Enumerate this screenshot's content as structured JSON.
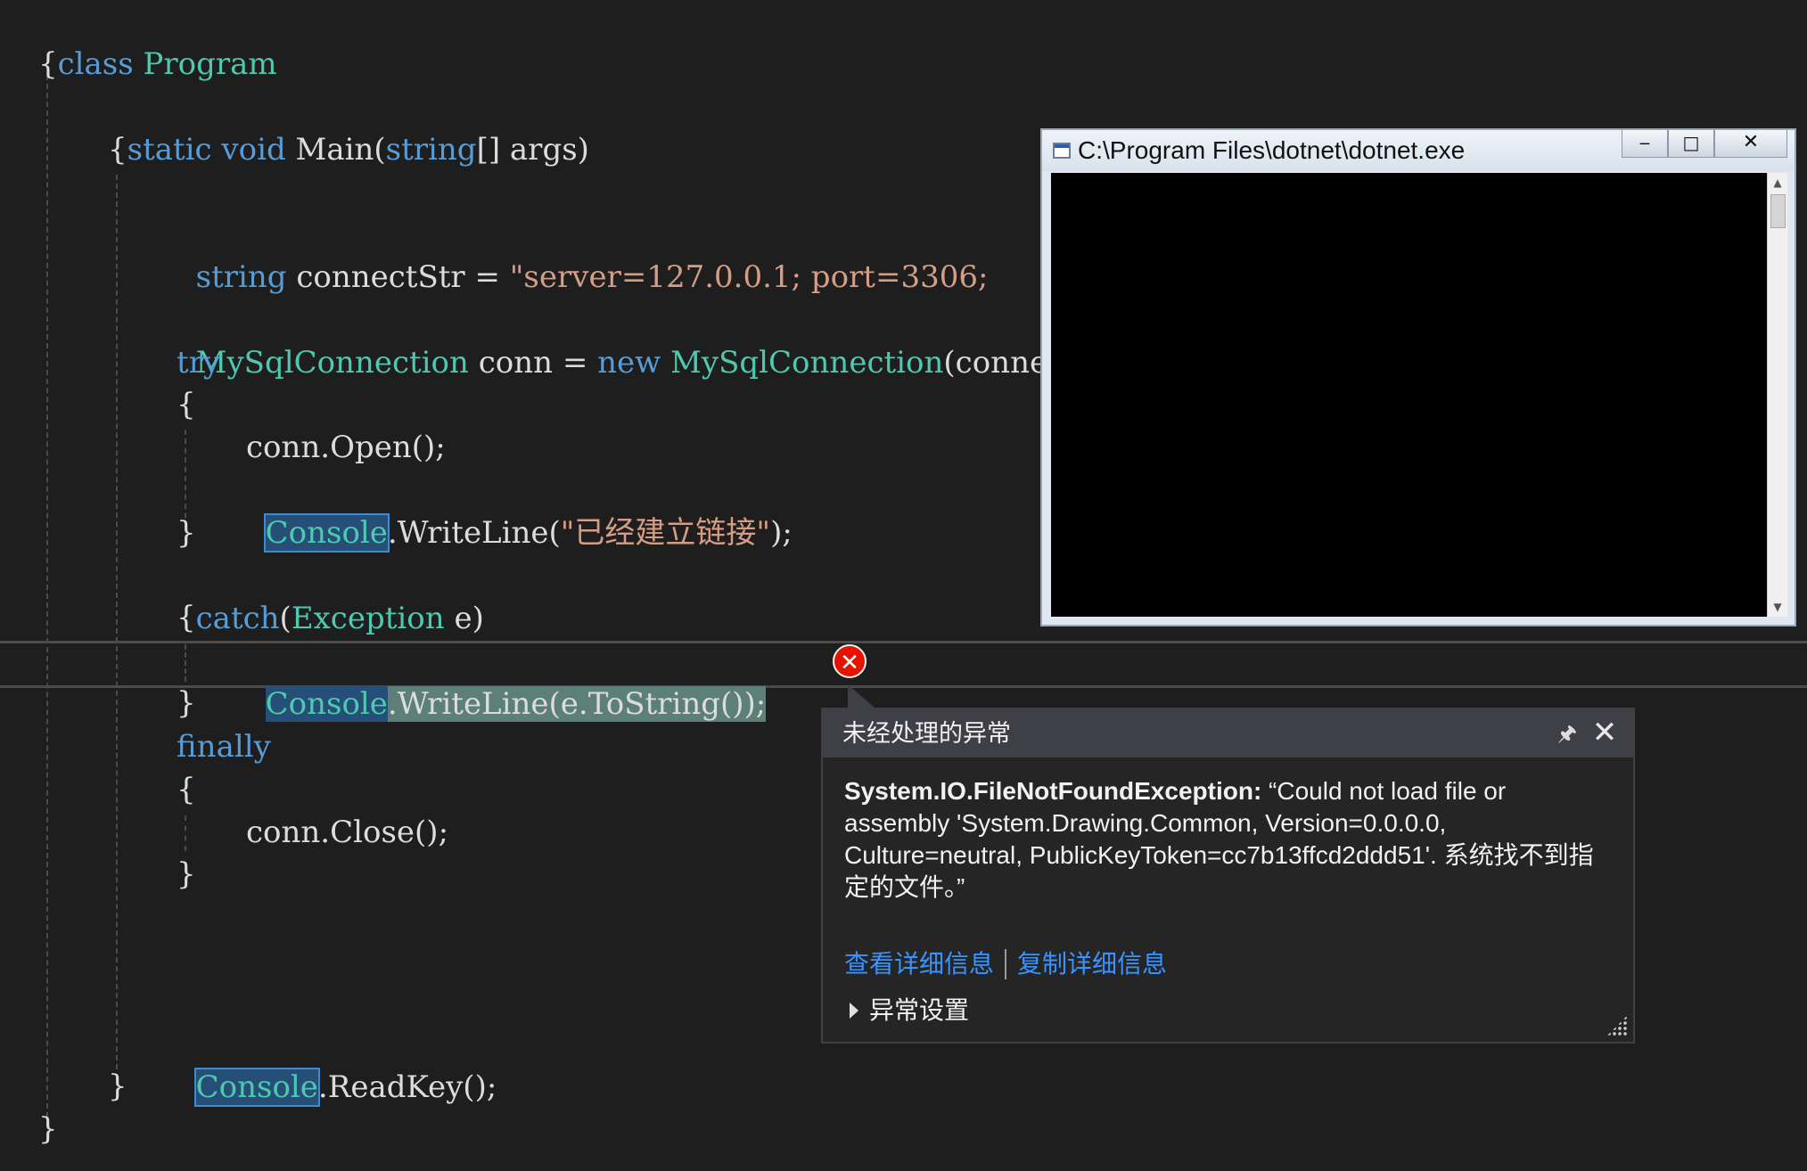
{
  "editor": {
    "lines": {
      "l1": {
        "kw": "class",
        "name": "Program"
      },
      "l2": {
        "text": "{"
      },
      "l3": {
        "kw1": "static",
        "kw2": "void",
        "name": "Main",
        "open": "(",
        "type": "string",
        "rest": "[] args)"
      },
      "l4": {
        "text": "{"
      },
      "l5": {
        "type": "string",
        "name": " connectStr = ",
        "str": "\"server=127.0.0.1; port=3306;"
      },
      "l6": {
        "type": "MySqlConnection",
        "mid": " conn = ",
        "kw": "new",
        "type2": "MySqlConnection",
        "rest": "(connect"
      },
      "l7": {
        "kw": "try"
      },
      "l8": {
        "text": "{"
      },
      "l9": {
        "text": "conn.Open();"
      },
      "l10": {
        "type": "Console",
        "mid": ".WriteLine(",
        "str": "\"已经建立链接\"",
        "end": ");"
      },
      "l11": {
        "text": "}"
      },
      "l12": {
        "kw": "catch",
        "open": "(",
        "type": "Exception",
        "rest": " e)"
      },
      "l13": {
        "text": "{"
      },
      "l14": {
        "type": "Console",
        "rest": ".WriteLine(e.ToString());"
      },
      "l15": {
        "text": "}"
      },
      "l16": {
        "kw": "finally"
      },
      "l17": {
        "text": "{"
      },
      "l18": {
        "text": "conn.Close();"
      },
      "l19": {
        "text": "}"
      },
      "l20": {
        "type": "Console",
        "rest": ".ReadKey();"
      },
      "l21": {
        "text": "}"
      },
      "l22": {
        "text": "}"
      }
    }
  },
  "console_window": {
    "title": "C:\\Program Files\\dotnet\\dotnet.exe",
    "minimize": "‒",
    "maximize": "□",
    "close": "✕"
  },
  "exception_popup": {
    "title": "未经处理的异常",
    "exception_type": "System.IO.FileNotFoundException:",
    "message": " “Could not load file or assembly 'System.Drawing.Common, Version=0.0.0.0, Culture=neutral, PublicKeyToken=cc7b13ffcd2ddd51'. 系统找不到指定的文件。”",
    "link_view_details": "查看详细信息",
    "link_copy_details": "复制详细信息",
    "settings_label": "异常设置",
    "pin_glyph": "🖈",
    "close_glyph": "✕"
  },
  "error_glyph": "✕",
  "colors": {
    "background": "#1e1e1e",
    "keyword": "#569cd6",
    "type": "#4ec9b0",
    "string": "#d69d85",
    "text": "#dcdcdc",
    "link": "#3794ff",
    "error": "#e51400"
  }
}
